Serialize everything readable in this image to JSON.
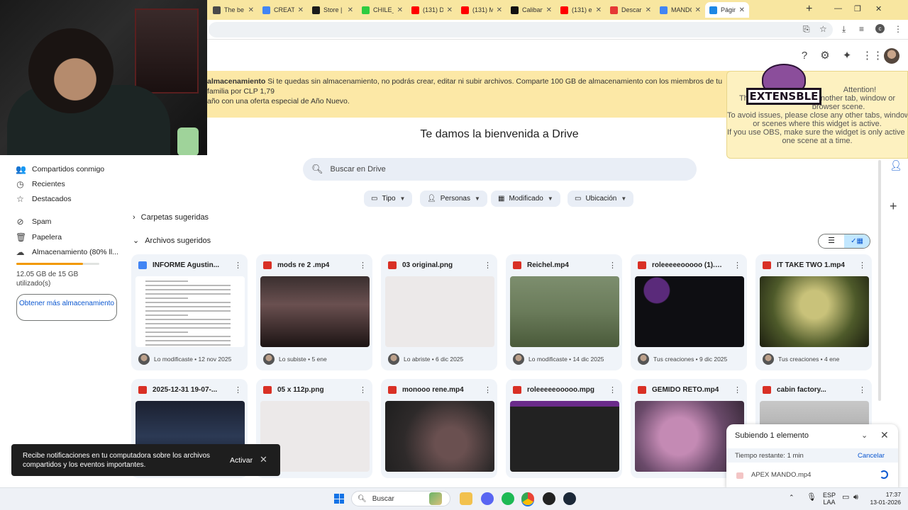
{
  "browser": {
    "tabs": [
      {
        "label": "The be",
        "color": "#4a4a4a"
      },
      {
        "label": "CREATI",
        "color": "#4285f4"
      },
      {
        "label": "Store |",
        "color": "#1b1b1b"
      },
      {
        "label": "CHILE_",
        "color": "#2ecc40"
      },
      {
        "label": "(131) D",
        "color": "#ff0000"
      },
      {
        "label": "(131) M",
        "color": "#ff0000"
      },
      {
        "label": "Caliban",
        "color": "#111111"
      },
      {
        "label": "(131) e",
        "color": "#ff0000"
      },
      {
        "label": "Descar",
        "color": "#e53935"
      },
      {
        "label": "MANDO",
        "color": "#4285f4"
      },
      {
        "label": "Página",
        "color": "#1e88e5"
      }
    ]
  },
  "banner": {
    "bold": "almacenamiento",
    "text": " Si te quedas sin almacenamiento, no podrás crear, editar ni subir archivos. Comparte 100 GB de almacenamiento con los miembros de tu familia por CLP 1,79",
    "line2": "año con una oferta especial de Año Nuevo."
  },
  "extension": {
    "logo_text": "EXTENSBLE",
    "line1": "Attention!",
    "line2": "This widget is open in another tab, window or",
    "line3": "browser scene.",
    "line4": "To avoid issues, please close any other tabs, windows",
    "line5": "or scenes where this widget is active.",
    "line6": "If you use OBS, make sure the widget is only active in",
    "line7": "one scene at a time."
  },
  "sidebar": {
    "items": [
      {
        "label": "Compartidos conmigo",
        "icon": "people-icon"
      },
      {
        "label": "Recientes",
        "icon": "clock-icon"
      },
      {
        "label": "Destacados",
        "icon": "star-icon"
      },
      {
        "label": "Spam",
        "icon": "spam-icon"
      },
      {
        "label": "Papelera",
        "icon": "trash-icon"
      },
      {
        "label": "Almacenamiento (80% ll...",
        "icon": "cloud-icon"
      }
    ],
    "storage_fraction": 0.8,
    "storage_text": "12.05 GB de 15 GB utilizado(s)",
    "get_more": "Obtener más almacenamiento"
  },
  "main": {
    "welcome": "Te damos la bienvenida a Drive",
    "search_placeholder": "Buscar en Drive",
    "chips": [
      {
        "label": "Tipo",
        "icon": "file-type-icon"
      },
      {
        "label": "Personas",
        "icon": "person-icon"
      },
      {
        "label": "Modificado",
        "icon": "calendar-icon"
      },
      {
        "label": "Ubicación",
        "icon": "folder-icon"
      }
    ],
    "suggested_folders": "Carpetas sugeridas",
    "suggested_files": "Archivos sugeridos"
  },
  "files": [
    {
      "name": "INFORME Agustin...",
      "type": "doc",
      "meta": "Lo modificaste • 12 nov 2025"
    },
    {
      "name": "mods re 2 .mp4",
      "type": "video",
      "meta": "Lo subiste • 5 ene"
    },
    {
      "name": "03 original.png",
      "type": "image",
      "meta": "Lo abriste • 6 dic 2025"
    },
    {
      "name": "Reichel.mp4",
      "type": "video",
      "meta": "Lo modificaste • 14 dic 2025"
    },
    {
      "name": "roleeeeeooooo (1).mpg",
      "type": "video",
      "meta": "Tus creaciones • 9 dic 2025"
    },
    {
      "name": "IT TAKE TWO 1.mp4",
      "type": "video",
      "meta": "Tus creaciones • 4 ene"
    },
    {
      "name": "2025-12-31 19-07-...",
      "type": "video",
      "meta": ""
    },
    {
      "name": "05 x 112p.png",
      "type": "image",
      "meta": ""
    },
    {
      "name": "monooo rene.mp4",
      "type": "video",
      "meta": ""
    },
    {
      "name": "roleeeeeooooo.mpg",
      "type": "video",
      "meta": ""
    },
    {
      "name": "GEMIDO RETO.mp4",
      "type": "video",
      "meta": ""
    },
    {
      "name": "cabin factory...",
      "type": "video",
      "meta": ""
    }
  ],
  "toast": {
    "message": "Recibe notificaciones en tu computadora sobre los archivos compartidos y los eventos importantes.",
    "action": "Activar"
  },
  "upload": {
    "title": "Subiendo 1 elemento",
    "remaining": "Tiempo restante: 1 min",
    "cancel": "Cancelar",
    "file": "APEX MANDO.mp4"
  },
  "taskbar": {
    "search": "Buscar",
    "lang1": "ESP",
    "lang2": "LAA",
    "time": "17:37",
    "date": "13-01-2026"
  }
}
